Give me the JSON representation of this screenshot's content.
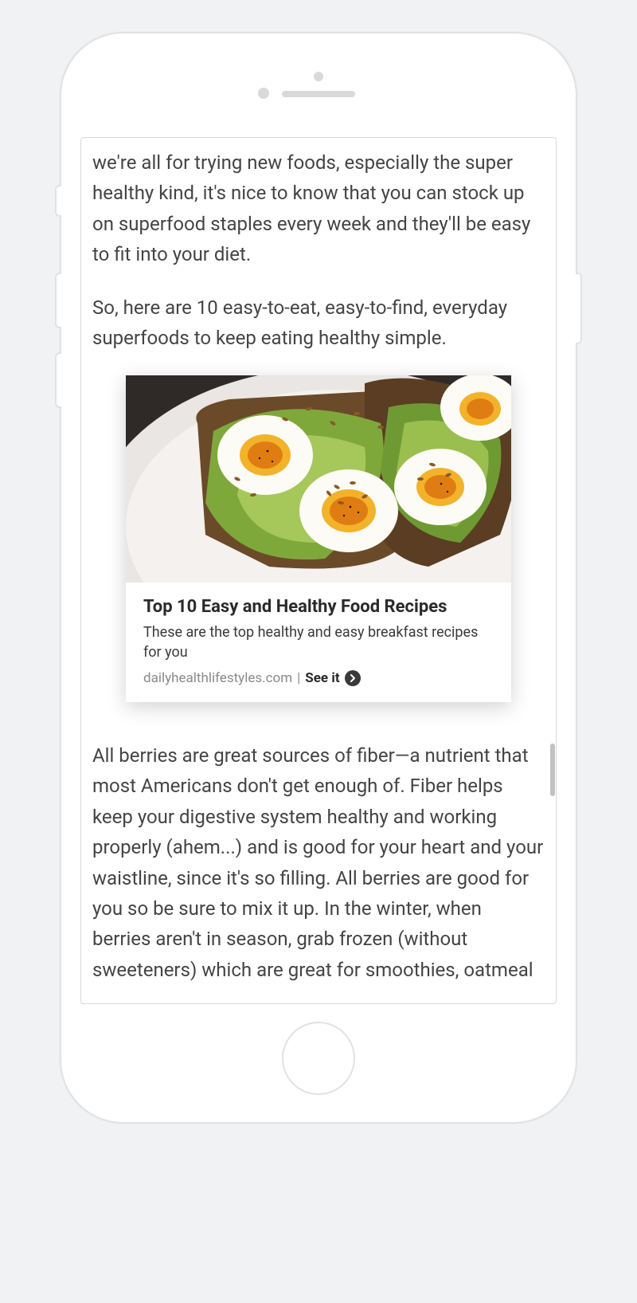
{
  "article": {
    "para1": "we're all for trying new foods, especially the super healthy kind, it's nice to know that you can stock up on superfood staples every week and they'll be easy to fit into your diet.",
    "para2": "So, here are 10 easy-to-eat, easy-to-find, everyday superfoods to keep eating healthy simple.",
    "para3": "All berries are great sources of fiber—a nutrient that most Americans don't get enough of. Fiber helps keep your digestive system healthy and working properly (ahem...) and is good for your heart and your waistline, since it's so filling. All berries are good for you so be sure to mix it up. In the winter, when berries aren't in season, grab frozen (without sweeteners) which are great for smoothies, oatmeal"
  },
  "ad": {
    "title": "Top 10 Easy and Healthy Food Recipes",
    "description": "These are the top healthy and easy breakfast recipes for you",
    "domain": "dailyhealthlifestyles.com",
    "separator": "|",
    "cta": "See it",
    "image_alt": "avocado toast with eggs on white plate"
  }
}
